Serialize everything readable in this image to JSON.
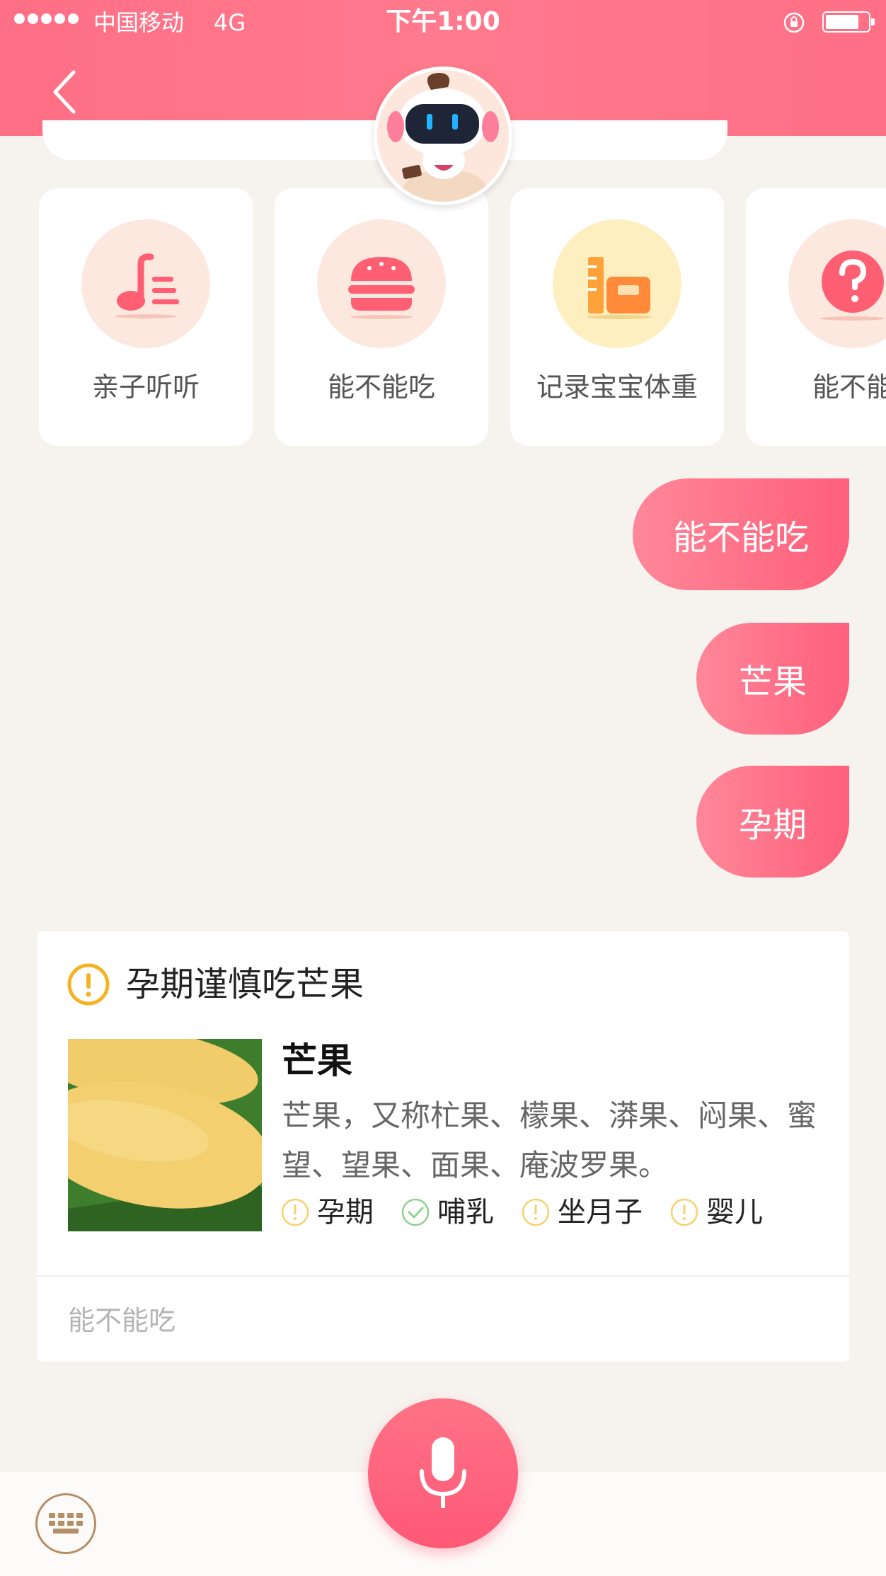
{
  "status_bar": {
    "carrier": "中国移动",
    "network": "4G",
    "time": "下午1:00"
  },
  "quick_actions": [
    {
      "label": "亲子听听",
      "icon": "music-note-icon"
    },
    {
      "label": "能不能吃",
      "icon": "burger-icon"
    },
    {
      "label": "记录宝宝体重",
      "icon": "scale-icon"
    },
    {
      "label": "能不能",
      "icon": "question-icon"
    }
  ],
  "messages": [
    {
      "text": "能不能吃"
    },
    {
      "text": "芒果"
    },
    {
      "text": "孕期"
    }
  ],
  "answer": {
    "title": "孕期谨慎吃芒果",
    "food_name": "芒果",
    "description": "芒果，又称杧果、檬果、漭果、闷果、蜜望、望果、面果、庵波罗果。",
    "tags": [
      {
        "label": "孕期",
        "status": "caution"
      },
      {
        "label": "哺乳",
        "status": "ok"
      },
      {
        "label": "坐月子",
        "status": "caution"
      },
      {
        "label": "婴儿",
        "status": "caution"
      }
    ],
    "footer": "能不能吃"
  },
  "colors": {
    "accent": "#ff6f86",
    "background": "#f6f3ef",
    "warning": "#f5b321",
    "ok": "#8fd18f"
  }
}
